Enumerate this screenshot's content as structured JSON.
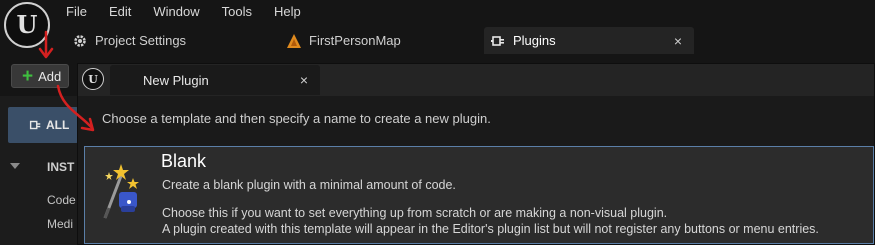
{
  "menu": [
    "File",
    "Edit",
    "Window",
    "Tools",
    "Help"
  ],
  "tabs": {
    "project_settings": "Project Settings",
    "map": "FirstPersonMap",
    "plugins": "Plugins",
    "close": "×"
  },
  "toolbar": {
    "add_label": "Add"
  },
  "left_panel": {
    "all_label": "ALL",
    "category_title": "INST",
    "items": [
      "Code",
      "Medi"
    ]
  },
  "dialog": {
    "tab_label": "New Plugin",
    "close": "×",
    "instructions": "Choose a template and then specify a name to create a new plugin.",
    "template": {
      "name": "Blank",
      "description": "Create a blank plugin with a minimal amount of code.",
      "detail_1": "Choose this if you want to set everything up from scratch or are making a non-visual plugin.",
      "detail_2": "A plugin created with this template will appear in the Editor's plugin list but will not register any buttons or menu entries."
    }
  },
  "colors": {
    "accent_blue": "#5b7fa8",
    "add_plus": "#3fbf3f",
    "annotation_red": "#d42020"
  },
  "icons": [
    "unreal-logo-icon",
    "gear-icon",
    "map-icon",
    "plugin-icon",
    "close-icon",
    "plus-icon",
    "magic-wand-icon"
  ]
}
